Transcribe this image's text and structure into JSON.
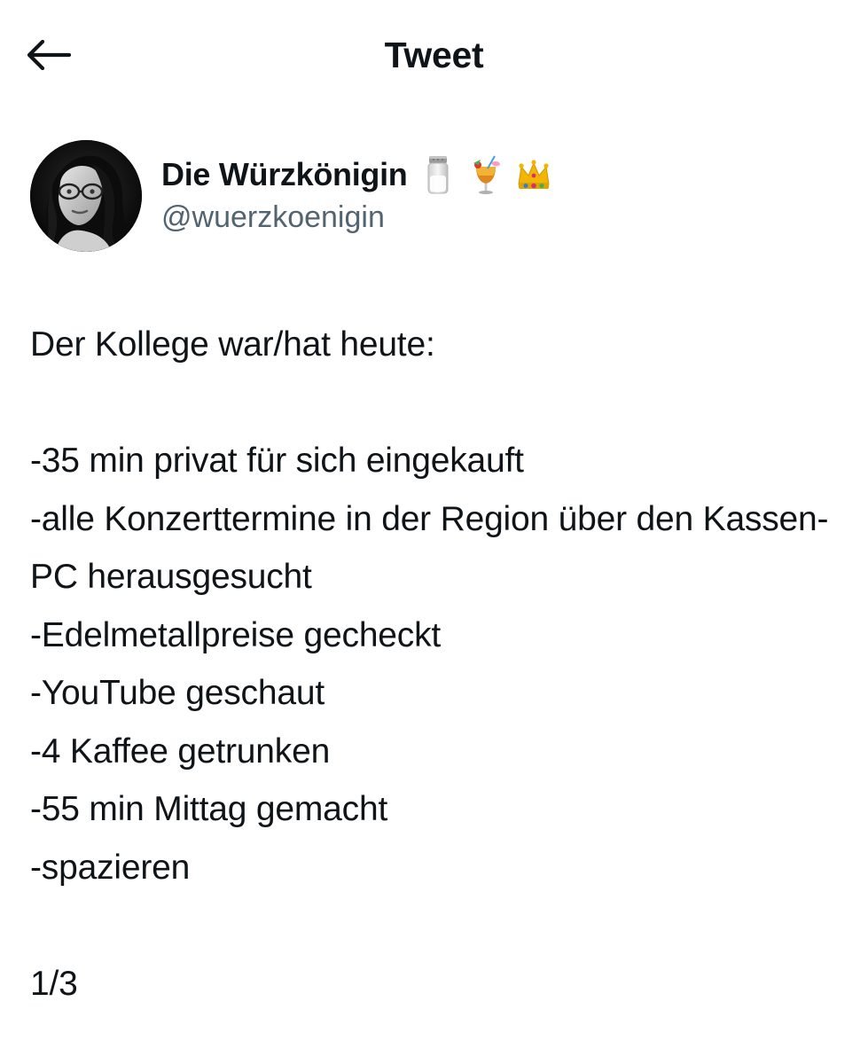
{
  "header": {
    "title": "Tweet",
    "back_icon": "arrow-left-icon"
  },
  "author": {
    "name": "Die Würzkönigin",
    "handle": "@wuerzkoenigin",
    "name_emojis": [
      "salt-shaker-icon",
      "tropical-drink-icon",
      "crown-icon"
    ]
  },
  "tweet": {
    "text": "Der Kollege war/hat heute:\n\n-35 min privat für sich eingekauft\n-alle Konzerttermine in der Region über den Kassen-PC herausgesucht\n-Edelmetallpreise gecheckt\n-YouTube geschaut\n-4 Kaffee getrunken\n-55 min Mittag gemacht\n-spazieren\n\n1/3"
  },
  "colors": {
    "text": "#0f1419",
    "secondary_text": "#536471",
    "background": "#ffffff"
  }
}
